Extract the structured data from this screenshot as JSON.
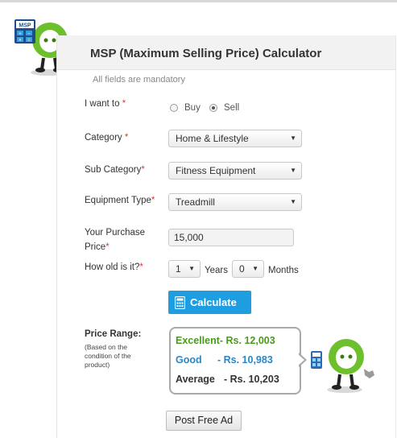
{
  "header": {
    "title": "MSP (Maximum Selling Price) Calculator",
    "badge_text": "MSP"
  },
  "form": {
    "mandatory_note": "All fields are mandatory",
    "i_want_to": {
      "label": "I want to",
      "required": "*",
      "options": [
        "Buy",
        "Sell"
      ],
      "selected": "Sell"
    },
    "category": {
      "label": "Category",
      "required": "*",
      "value": "Home & Lifestyle"
    },
    "sub_category": {
      "label": "Sub Category",
      "required": "*",
      "value": "Fitness Equipment"
    },
    "equipment_type": {
      "label": "Equipment Type",
      "required": "*",
      "value": "Treadmill"
    },
    "purchase_price": {
      "label_line1": "Your Purchase",
      "label_line2": "Price",
      "required": "*",
      "value": "15,000"
    },
    "age": {
      "label": "How old is it?",
      "required": "*",
      "years_value": "1",
      "years_unit": "Years",
      "months_value": "0",
      "months_unit": "Months"
    },
    "calculate_label": "Calculate"
  },
  "price_range": {
    "label": "Price Range:",
    "note_lines": [
      "(Based on the",
      "condition of the",
      "product)"
    ],
    "rows": [
      {
        "condition": "Excellent",
        "price": "- Rs. 12,003",
        "color": "#4a9a1e"
      },
      {
        "condition": "Good",
        "price": "- Rs. 10,983",
        "color": "#2b86c6"
      },
      {
        "condition": "Average",
        "price": "- Rs. 10,203",
        "color": "#333333"
      }
    ]
  },
  "post_ad_label": "Post Free Ad",
  "icons": {
    "mascot": "mascot-icon",
    "calculator": "calculator-icon",
    "dropdown": "chevron-down-icon"
  },
  "colors": {
    "accent_blue": "#1e9de0",
    "mascot_green": "#6cc02b",
    "required_red": "#e53935"
  }
}
